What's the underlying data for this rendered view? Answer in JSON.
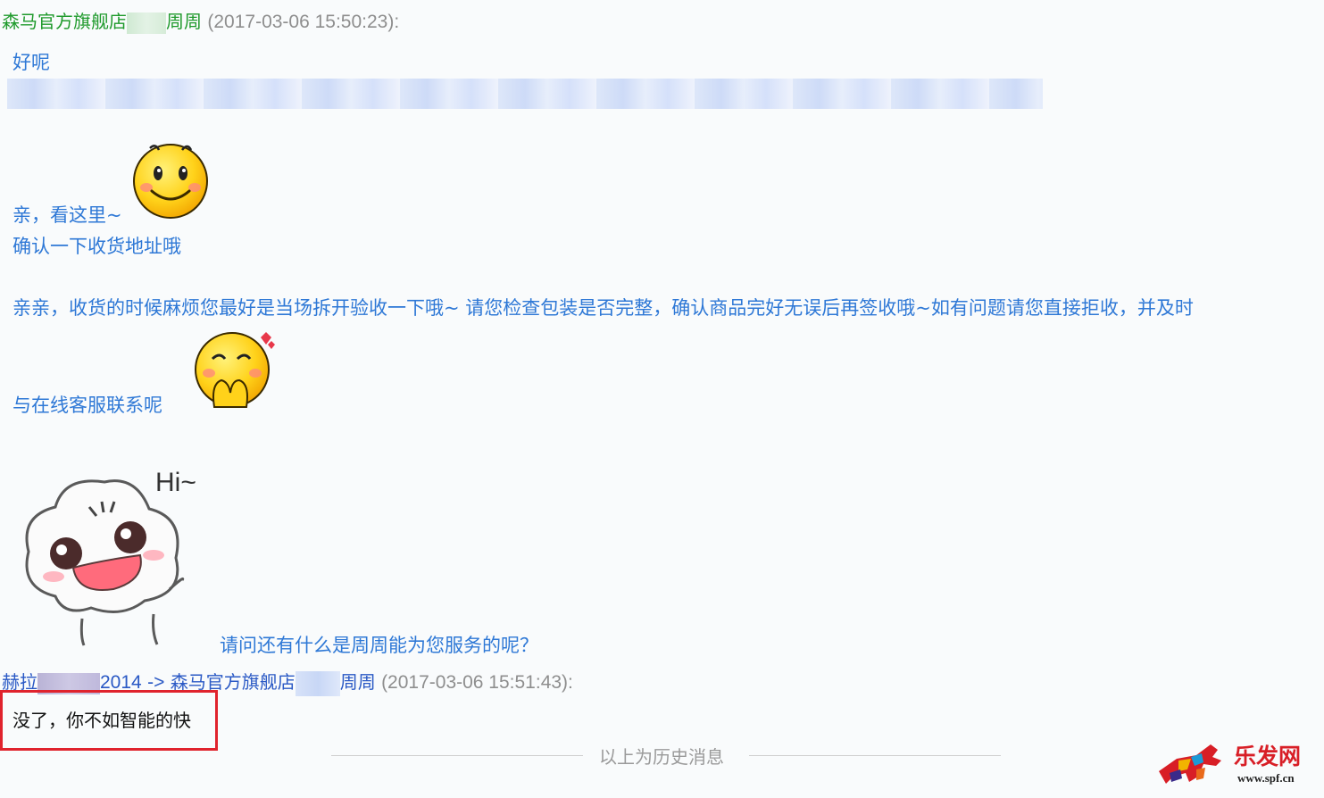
{
  "message1": {
    "sender_prefix": "森马官方旗舰店",
    "sender_suffix": "周周",
    "timestamp": "(2017-03-06 15:50:23):",
    "lines": {
      "ok": "好呢",
      "look_here": "亲，看这里~",
      "confirm_address": "确认一下收货地址哦",
      "inspect_notice": "亲亲，收货的时候麻烦您最好是当场拆开验收一下哦~ 请您检查包装是否完整，确认商品完好无误后再签收哦~如有问题请您直接拒收，并及时",
      "contact": "与在线客服联系呢",
      "anything_else": "请问还有什么是周周能为您服务的呢？"
    },
    "sticker_text": "Hi~"
  },
  "message2": {
    "sender_prefix": "赫拉",
    "sender_number": "2014",
    "arrow": "->",
    "recipient_prefix": "森马官方旗舰店",
    "recipient_suffix": "周周",
    "timestamp": "(2017-03-06 15:51:43):",
    "text": "没了，你不如智能的快"
  },
  "divider_text": "以上为历史消息",
  "watermark": {
    "brand": "乐发网",
    "url": "www.spf.cn"
  },
  "colors": {
    "seller_name": "#1f9a2c",
    "seller_message": "#2e78d6",
    "buyer_name": "#2a59c5",
    "highlight_box": "#e0232d"
  },
  "icons": [
    "smiley-icon",
    "shy-smiley-icon",
    "cloud-hi-sticker"
  ]
}
